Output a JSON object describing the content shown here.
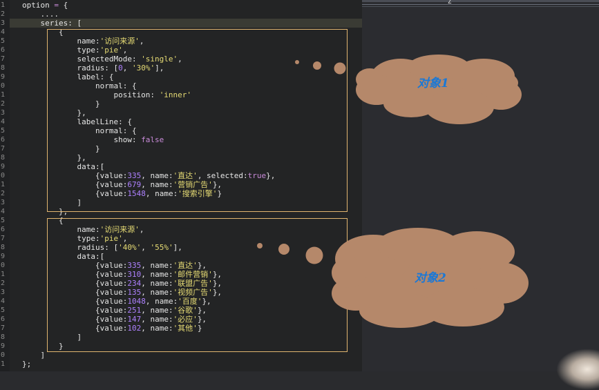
{
  "editor": {
    "line_numbers": [
      "1",
      "2",
      "3",
      "4",
      "5",
      "6",
      "7",
      "8",
      "9",
      "0",
      "1",
      "2",
      "3",
      "4",
      "5",
      "6",
      "7",
      "8",
      "9",
      "0",
      "1",
      "2",
      "3",
      "4",
      "5",
      "6",
      "7",
      "8",
      "9",
      "0",
      "1",
      "2",
      "3",
      "4",
      "5",
      "6",
      "7",
      "8",
      "9",
      "0",
      "1"
    ],
    "lines": [
      [
        {
          "t": "option ",
          "c": "p"
        },
        {
          "t": "=",
          "c": "k"
        },
        {
          "t": " {",
          "c": "p"
        }
      ],
      [
        {
          "t": "    ....",
          "c": "p"
        }
      ],
      [
        {
          "t": "    series: [",
          "c": "p"
        }
      ],
      [
        {
          "t": "        {",
          "c": "p"
        }
      ],
      [
        {
          "t": "            name:",
          "c": "p"
        },
        {
          "t": "'访问来源'",
          "c": "s"
        },
        {
          "t": ",",
          "c": "p"
        }
      ],
      [
        {
          "t": "            type:",
          "c": "p"
        },
        {
          "t": "'pie'",
          "c": "s"
        },
        {
          "t": ",",
          "c": "p"
        }
      ],
      [
        {
          "t": "            selectedMode: ",
          "c": "p"
        },
        {
          "t": "'single'",
          "c": "s"
        },
        {
          "t": ",",
          "c": "p"
        }
      ],
      [
        {
          "t": "            radius: [",
          "c": "p"
        },
        {
          "t": "0",
          "c": "n"
        },
        {
          "t": ", ",
          "c": "p"
        },
        {
          "t": "'30%'",
          "c": "s"
        },
        {
          "t": "],",
          "c": "p"
        }
      ],
      [
        {
          "t": "            label: {",
          "c": "p"
        }
      ],
      [
        {
          "t": "                normal: {",
          "c": "p"
        }
      ],
      [
        {
          "t": "                    position: ",
          "c": "p"
        },
        {
          "t": "'inner'",
          "c": "s"
        }
      ],
      [
        {
          "t": "                }",
          "c": "p"
        }
      ],
      [
        {
          "t": "            },",
          "c": "p"
        }
      ],
      [
        {
          "t": "            labelLine: {",
          "c": "p"
        }
      ],
      [
        {
          "t": "                normal: {",
          "c": "p"
        }
      ],
      [
        {
          "t": "                    show: ",
          "c": "p"
        },
        {
          "t": "false",
          "c": "k"
        }
      ],
      [
        {
          "t": "                }",
          "c": "p"
        }
      ],
      [
        {
          "t": "            },",
          "c": "p"
        }
      ],
      [
        {
          "t": "            data:[",
          "c": "p"
        }
      ],
      [
        {
          "t": "                {value:",
          "c": "p"
        },
        {
          "t": "335",
          "c": "n"
        },
        {
          "t": ", name:",
          "c": "p"
        },
        {
          "t": "'直达'",
          "c": "s"
        },
        {
          "t": ", selected:",
          "c": "p"
        },
        {
          "t": "true",
          "c": "k"
        },
        {
          "t": "},",
          "c": "p"
        }
      ],
      [
        {
          "t": "                {value:",
          "c": "p"
        },
        {
          "t": "679",
          "c": "n"
        },
        {
          "t": ", name:",
          "c": "p"
        },
        {
          "t": "'营销广告'",
          "c": "s"
        },
        {
          "t": "},",
          "c": "p"
        }
      ],
      [
        {
          "t": "                {value:",
          "c": "p"
        },
        {
          "t": "1548",
          "c": "n"
        },
        {
          "t": ", name:",
          "c": "p"
        },
        {
          "t": "'搜索引擎'",
          "c": "s"
        },
        {
          "t": "}",
          "c": "p"
        }
      ],
      [
        {
          "t": "            ]",
          "c": "p"
        }
      ],
      [
        {
          "t": "        },",
          "c": "p"
        }
      ],
      [
        {
          "t": "        {",
          "c": "p"
        }
      ],
      [
        {
          "t": "            name:",
          "c": "p"
        },
        {
          "t": "'访问来源'",
          "c": "s"
        },
        {
          "t": ",",
          "c": "p"
        }
      ],
      [
        {
          "t": "            type:",
          "c": "p"
        },
        {
          "t": "'pie'",
          "c": "s"
        },
        {
          "t": ",",
          "c": "p"
        }
      ],
      [
        {
          "t": "            radius: [",
          "c": "p"
        },
        {
          "t": "'40%'",
          "c": "s"
        },
        {
          "t": ", ",
          "c": "p"
        },
        {
          "t": "'55%'",
          "c": "s"
        },
        {
          "t": "],",
          "c": "p"
        }
      ],
      [
        {
          "t": "            data:[",
          "c": "p"
        }
      ],
      [
        {
          "t": "                {value:",
          "c": "p"
        },
        {
          "t": "335",
          "c": "n"
        },
        {
          "t": ", name:",
          "c": "p"
        },
        {
          "t": "'直达'",
          "c": "s"
        },
        {
          "t": "},",
          "c": "p"
        }
      ],
      [
        {
          "t": "                {value:",
          "c": "p"
        },
        {
          "t": "310",
          "c": "n"
        },
        {
          "t": ", name:",
          "c": "p"
        },
        {
          "t": "'邮件营销'",
          "c": "s"
        },
        {
          "t": "},",
          "c": "p"
        }
      ],
      [
        {
          "t": "                {value:",
          "c": "p"
        },
        {
          "t": "234",
          "c": "n"
        },
        {
          "t": ", name:",
          "c": "p"
        },
        {
          "t": "'联盟广告'",
          "c": "s"
        },
        {
          "t": "},",
          "c": "p"
        }
      ],
      [
        {
          "t": "                {value:",
          "c": "p"
        },
        {
          "t": "135",
          "c": "n"
        },
        {
          "t": ", name:",
          "c": "p"
        },
        {
          "t": "'视频广告'",
          "c": "s"
        },
        {
          "t": "},",
          "c": "p"
        }
      ],
      [
        {
          "t": "                {value:",
          "c": "p"
        },
        {
          "t": "1048",
          "c": "n"
        },
        {
          "t": ", name:",
          "c": "p"
        },
        {
          "t": "'百度'",
          "c": "s"
        },
        {
          "t": "},",
          "c": "p"
        }
      ],
      [
        {
          "t": "                {value:",
          "c": "p"
        },
        {
          "t": "251",
          "c": "n"
        },
        {
          "t": ", name:",
          "c": "p"
        },
        {
          "t": "'谷歌'",
          "c": "s"
        },
        {
          "t": "},",
          "c": "p"
        }
      ],
      [
        {
          "t": "                {value:",
          "c": "p"
        },
        {
          "t": "147",
          "c": "n"
        },
        {
          "t": ", name:",
          "c": "p"
        },
        {
          "t": "'必应'",
          "c": "s"
        },
        {
          "t": "},",
          "c": "p"
        }
      ],
      [
        {
          "t": "                {value:",
          "c": "p"
        },
        {
          "t": "102",
          "c": "n"
        },
        {
          "t": ", name:",
          "c": "p"
        },
        {
          "t": "'其他'",
          "c": "s"
        },
        {
          "t": "}",
          "c": "p"
        }
      ],
      [
        {
          "t": "            ]",
          "c": "p"
        }
      ],
      [
        {
          "t": "        }",
          "c": "p"
        }
      ],
      [
        {
          "t": "    ]",
          "c": "p"
        }
      ],
      [
        {
          "t": "};",
          "c": "p"
        }
      ]
    ]
  },
  "annotations": {
    "cloud1_label": "对象1",
    "cloud2_label": "对象2"
  },
  "colors": {
    "cloud": "#b5886a",
    "box_border": "#e2b670",
    "label": "#1a78d6"
  },
  "window": {
    "mark": "Z"
  }
}
